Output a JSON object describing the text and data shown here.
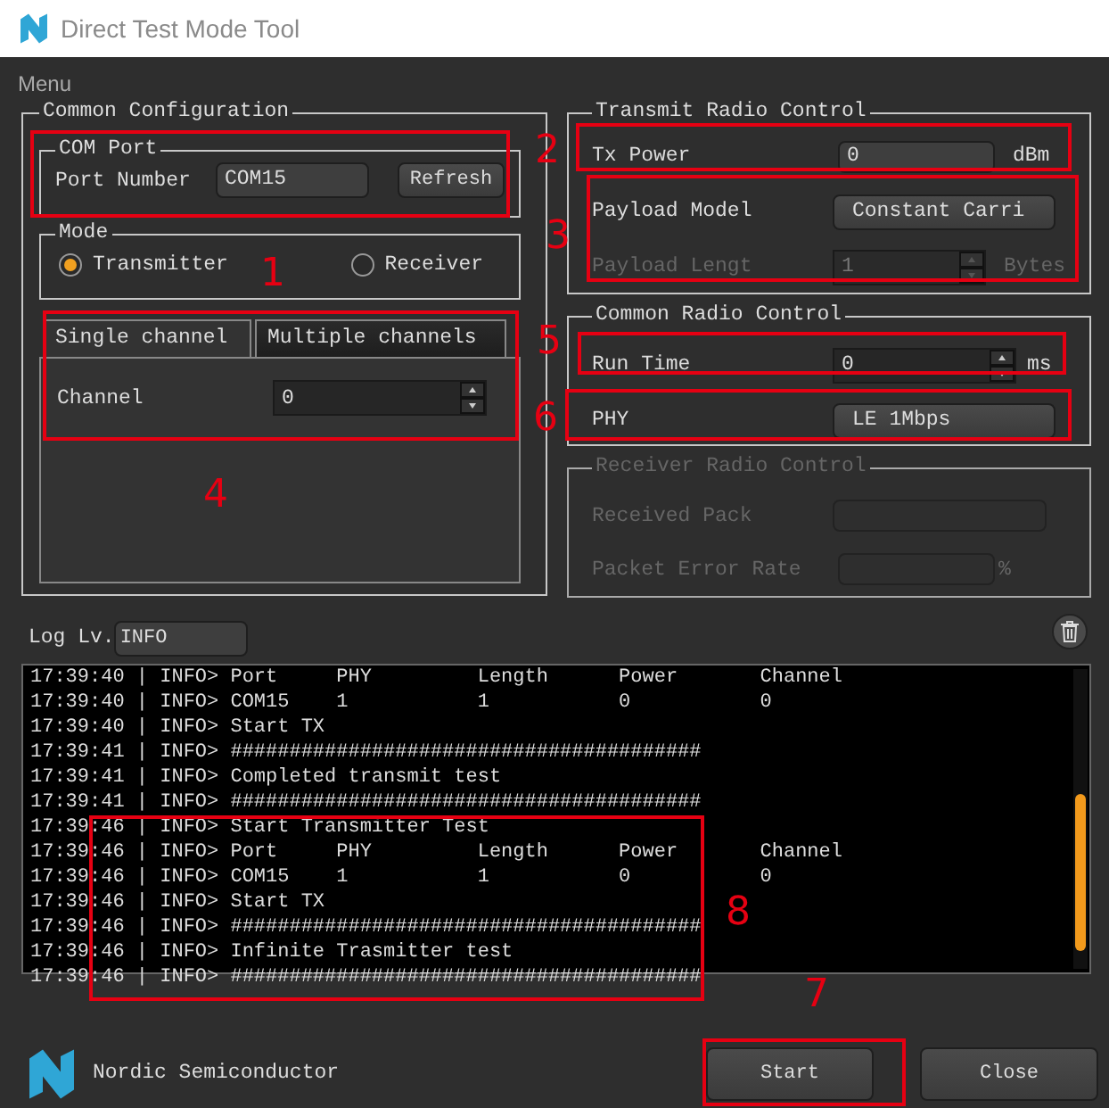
{
  "window": {
    "title": "Direct Test Mode Tool"
  },
  "menu": [
    {
      "label": "Menu"
    }
  ],
  "common_configuration": {
    "title": "Common Configuration",
    "com_port": {
      "title": "COM Port",
      "label": "Port Number",
      "value": "COM15",
      "button": "Refresh"
    },
    "mode": {
      "title": "Mode",
      "options": [
        {
          "label": "Transmitter",
          "selected": true
        },
        {
          "label": "Receiver",
          "selected": false
        }
      ]
    },
    "tabs": [
      {
        "label": "Single channel",
        "selected": true
      },
      {
        "label": "Multiple channels",
        "selected": false
      }
    ],
    "channel": {
      "label": "Channel",
      "value": "0"
    }
  },
  "radio_groups": [
    {
      "title": "Transmit Radio Control",
      "disabled": false,
      "rows": [
        {
          "kind": "field",
          "label": "Tx Power",
          "value": "0",
          "unit": "dBm",
          "disabled": false
        },
        {
          "kind": "button",
          "label": "Payload Model",
          "value": "Constant Carri",
          "disabled": false
        },
        {
          "kind": "spin",
          "label": "Payload Lengt",
          "value": "1",
          "unit": "Bytes",
          "disabled": true
        }
      ]
    },
    {
      "title": "Common Radio Control",
      "disabled": false,
      "rows": [
        {
          "kind": "spin",
          "label": "Run Time",
          "value": "0",
          "unit": "ms",
          "disabled": false
        },
        {
          "kind": "button",
          "label": "PHY",
          "value": "LE 1Mbps",
          "disabled": false
        }
      ]
    },
    {
      "title": "Receiver Radio Control",
      "disabled": true,
      "rows": [
        {
          "kind": "field",
          "label": "Received Pack",
          "disabled": true
        },
        {
          "kind": "field",
          "label": "Packet Error Rate",
          "unit": "%",
          "disabled": true
        }
      ]
    }
  ],
  "log": {
    "level_label": "Log Lv.",
    "level": "INFO",
    "lines": [
      "17:39:40 | INFO> Port     PHY         Length      Power       Channel",
      "17:39:40 | INFO> COM15    1           1           0           0",
      "17:39:40 | INFO> Start TX",
      "17:39:41 | INFO> ########################################",
      "17:39:41 | INFO> Completed transmit test",
      "17:39:41 | INFO> ########################################",
      "17:39:46 | INFO> Start Transmitter Test",
      "17:39:46 | INFO> Port     PHY         Length      Power       Channel",
      "17:39:46 | INFO> COM15    1           1           0           0",
      "17:39:46 | INFO> Start TX",
      "17:39:46 | INFO> ########################################",
      "17:39:46 | INFO> Infinite Trasmitter test",
      "17:39:46 | INFO> ########################################"
    ]
  },
  "footer": {
    "brand": "Nordic Semiconductor",
    "buttons": [
      {
        "label": "Start"
      },
      {
        "label": "Close"
      }
    ]
  },
  "annotations": [
    {
      "label": "1"
    },
    {
      "label": "2"
    },
    {
      "label": "3"
    },
    {
      "label": "4"
    },
    {
      "label": "5"
    },
    {
      "label": "6"
    },
    {
      "label": "7"
    },
    {
      "label": "8"
    }
  ]
}
